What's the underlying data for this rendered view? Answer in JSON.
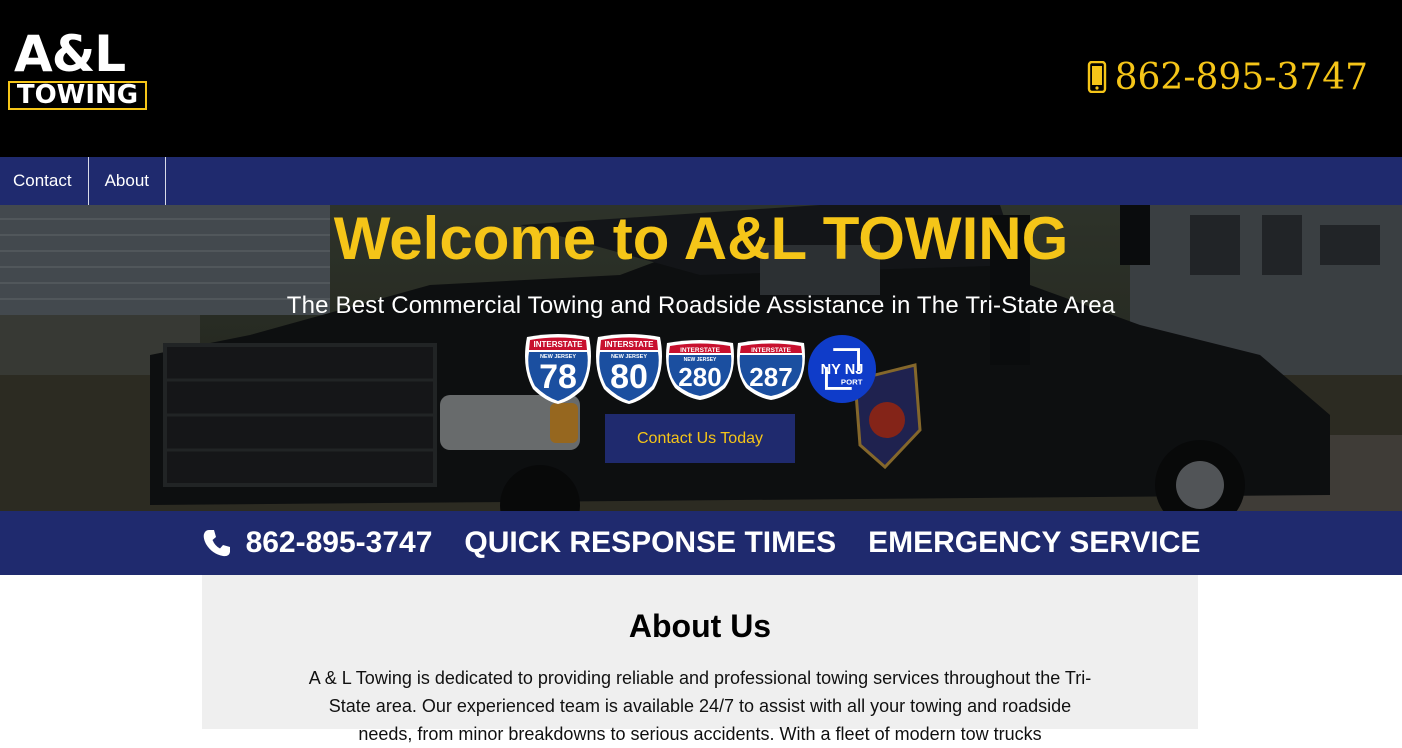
{
  "header": {
    "logo_top": "A&L",
    "logo_bottom": "TOWING",
    "phone": "862-895-3747",
    "phone_icon": "mobile-phone-icon"
  },
  "nav": {
    "items": [
      {
        "label": "Contact"
      },
      {
        "label": "About"
      }
    ]
  },
  "hero": {
    "title": "Welcome to A&L TOWING",
    "subtitle": "The Best Commercial Towing and Roadside Assistance in The Tri-State Area",
    "shields": [
      {
        "top": "INTERSTATE",
        "state": "NEW JERSEY",
        "number": "78"
      },
      {
        "top": "INTERSTATE",
        "state": "NEW JERSEY",
        "number": "80"
      },
      {
        "top": "INTERSTATE",
        "state": "NEW JERSEY",
        "number": "280"
      },
      {
        "top": "INTERSTATE",
        "state": "",
        "number": "287"
      }
    ],
    "port_logo": {
      "line1": "NY NJ",
      "line2": "PORT"
    },
    "cta_label": "Contact Us Today"
  },
  "infobar": {
    "phone": "862-895-3747",
    "response": "QUICK RESPONSE TIMES",
    "emergency": "EMERGENCY SERVICE"
  },
  "about": {
    "title": "About Us",
    "text": "A & L Towing is dedicated to providing reliable and professional towing services throughout the Tri-State area. Our experienced team is available 24/7 to assist with all your towing and roadside needs, from minor breakdowns to serious accidents. With a fleet of modern tow trucks"
  },
  "colors": {
    "brand_yellow": "#f5c518",
    "brand_navy": "#1f2a6e",
    "shield_blue": "#1b4fa0",
    "shield_red": "#c8102e",
    "port_blue": "#0f3cc9"
  }
}
